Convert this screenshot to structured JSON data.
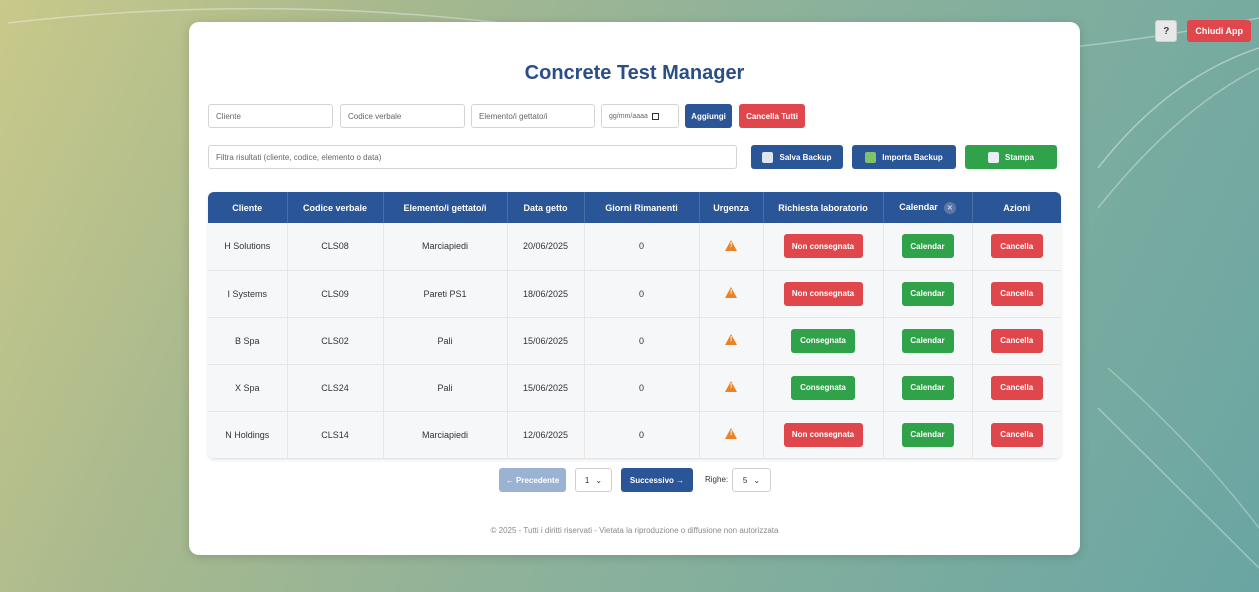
{
  "top_bar": {
    "help_label": "?",
    "close_label": "Chiudi App"
  },
  "title": "Concrete Test Manager",
  "form": {
    "cliente_placeholder": "Cliente",
    "codice_placeholder": "Codice verbale",
    "elemento_placeholder": "Elemento/i gettato/i",
    "date_placeholder": "gg/mm/aaaa",
    "add_label": "Aggiungi",
    "clear_all_label": "Cancella Tutti"
  },
  "filter": {
    "placeholder": "Filtra risultati (cliente, codice, elemento o data)",
    "save_backup_label": "Salva Backup",
    "import_backup_label": "Importa Backup",
    "print_label": "Stampa"
  },
  "table": {
    "headers": [
      "Cliente",
      "Codice verbale",
      "Elemento/i gettato/i",
      "Data getto",
      "Giorni Rimanenti",
      "Urgenza",
      "Richiesta laboratorio",
      "Calendar",
      "Azioni"
    ],
    "calendar_label": "Calendar",
    "delete_label": "Cancella",
    "rows": [
      {
        "cliente": "H Solutions",
        "codice": "CLS08",
        "elemento": "Marciapiedi",
        "data": "20/06/2025",
        "giorni": "0",
        "richiesta": "Non consegnata",
        "consegnata": false
      },
      {
        "cliente": "I Systems",
        "codice": "CLS09",
        "elemento": "Pareti PS1",
        "data": "18/06/2025",
        "giorni": "0",
        "richiesta": "Non consegnata",
        "consegnata": false
      },
      {
        "cliente": "B Spa",
        "codice": "CLS02",
        "elemento": "Pali",
        "data": "15/06/2025",
        "giorni": "0",
        "richiesta": "Consegnata",
        "consegnata": true
      },
      {
        "cliente": "X Spa",
        "codice": "CLS24",
        "elemento": "Pali",
        "data": "15/06/2025",
        "giorni": "0",
        "richiesta": "Consegnata",
        "consegnata": true
      },
      {
        "cliente": "N Holdings",
        "codice": "CLS14",
        "elemento": "Marciapiedi",
        "data": "12/06/2025",
        "giorni": "0",
        "richiesta": "Non consegnata",
        "consegnata": false
      }
    ]
  },
  "pagination": {
    "prev_label": "← Precedente",
    "page_value": "1",
    "next_label": "Successivo →",
    "rows_label": "Righe:",
    "rows_value": "5"
  },
  "footer": "© 2025 - Tutti i diritti riservati - Vietata la riproduzione o diffusione non autorizzata",
  "colors": {
    "primary": "#2a5596",
    "danger": "#e0474c",
    "success": "#2fa24a",
    "warning": "#e8832a"
  }
}
